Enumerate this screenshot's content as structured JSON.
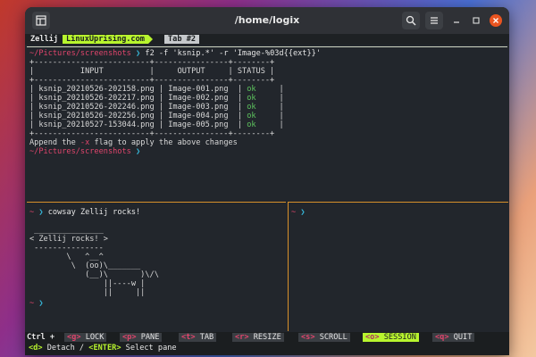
{
  "window": {
    "title": "/home/logix"
  },
  "tabs": {
    "session": "Zellij",
    "tab1": "LinuxUprising.com",
    "tab2": "Tab #2"
  },
  "top_pane": {
    "prompt_path": "~/Pictures/screenshots",
    "command": "f2 -f 'ksnip.*' -r 'Image-%03d{{ext}}'",
    "table_border": "+-------------------------+----------------+--------+",
    "table_header": "|          INPUT          |     OUTPUT     | STATUS |",
    "rows": [
      {
        "input": "ksnip_20210526-202158.png",
        "output": "Image-001.png",
        "status": "ok"
      },
      {
        "input": "ksnip_20210526-202217.png",
        "output": "Image-002.png",
        "status": "ok"
      },
      {
        "input": "ksnip_20210526-202246.png",
        "output": "Image-003.png",
        "status": "ok"
      },
      {
        "input": "ksnip_20210526-202256.png",
        "output": "Image-004.png",
        "status": "ok"
      },
      {
        "input": "ksnip_20210527-153044.png",
        "output": "Image-005.png",
        "status": "ok"
      }
    ],
    "append_before": "Append the ",
    "append_flag": "-x",
    "append_after": " flag to apply the above changes",
    "prompt_path_2": "~/Pictures/screenshots"
  },
  "bottom_left_pane": {
    "prompt_path": "~",
    "command": "cowsay Zellij rocks!",
    "cow_lines": [
      " _______________",
      "< Zellij rocks! >",
      " ---------------",
      "        \\   ^__^",
      "         \\  (oo)\\_______",
      "            (__)\\       )\\/\\",
      "                ||----w |",
      "                ||     ||"
    ],
    "prompt_path_2": "~"
  },
  "bottom_right_pane": {
    "prompt_path": "~"
  },
  "statusbar": {
    "ctrl": "Ctrl +",
    "items": [
      {
        "key": "<g>",
        "label": " LOCK"
      },
      {
        "key": "<p>",
        "label": " PANE"
      },
      {
        "key": "<t>",
        "label": " TAB"
      },
      {
        "key": "<r>",
        "label": " RESIZE"
      },
      {
        "key": "<s>",
        "label": " SCROLL"
      },
      {
        "key": "<o>",
        "label": " SESSION"
      },
      {
        "key": "<q>",
        "label": " QUIT"
      }
    ]
  },
  "hint": {
    "key1": "<d>",
    "text1": " Detach / ",
    "key2": "<ENTER>",
    "text2": " Select pane"
  },
  "colors": {
    "accent_green": "#b8f52e",
    "prompt_pink": "#e0456c",
    "prompt_arrow": "#36b7d9",
    "ok_green": "#5ec35e",
    "pane_border_active": "#d8902a"
  },
  "prompt_arrow_glyph": "❯"
}
